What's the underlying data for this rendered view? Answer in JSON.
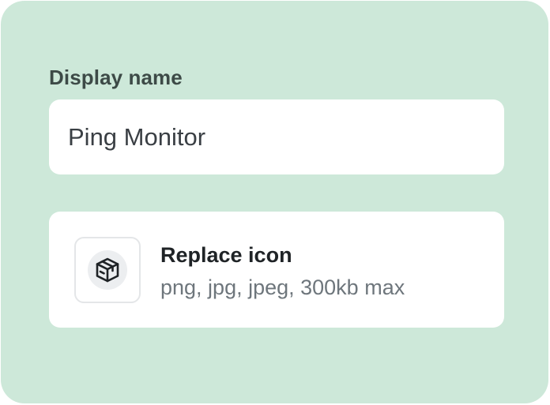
{
  "form": {
    "display_name_label": "Display name",
    "display_name_value": "Ping Monitor",
    "icon_upload": {
      "title": "Replace icon",
      "hint": "png, jpg, jpeg, 300kb max",
      "icon": "cube-icon"
    }
  },
  "colors": {
    "panel_background": "#cde8d9",
    "card_background": "#ffffff",
    "label_text": "#3d4a47",
    "muted_text": "#6e767c"
  }
}
